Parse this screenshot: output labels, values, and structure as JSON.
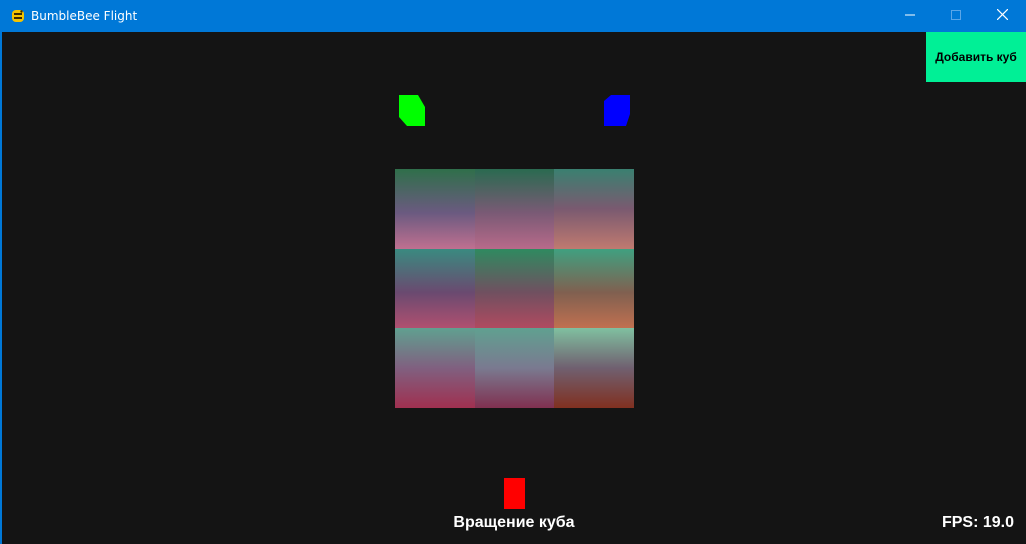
{
  "window": {
    "title": "BumbleBee Flight",
    "icon": "python-snake-icon",
    "controls": [
      "minimize-icon",
      "maximize-icon",
      "close-icon"
    ]
  },
  "canvas": {
    "background": "#141414",
    "add_cube_label": "Добавить куб",
    "add_cube_color": "#00f096",
    "caption": "Вращение куба",
    "fps_text": "FPS: 19.0"
  },
  "markers": {
    "green": "#00ff00",
    "blue": "#0000ff",
    "red": "#ff0000"
  },
  "cube_face": [
    "linear-gradient(to bottom, #2f6f4a 0%, #6b5a80 55%, #c07090 100%)",
    "linear-gradient(to bottom, #2a6a50 0%, #7a5a75 55%, #b86a8a 100%)",
    "linear-gradient(to bottom, #3a8070 0%, #7a5a70 50%, #c07a70 100%)",
    "linear-gradient(to bottom, #3a8a80 0%, #6a4a70 55%, #b05070 100%)",
    "linear-gradient(to bottom, #2f8a60 0%, #705060 55%, #b04a60 100%)",
    "linear-gradient(to bottom, #40a080 0%, #806050 55%, #c07050 100%)",
    "linear-gradient(to bottom, #60a090 0%, #806080 50%, #a03050 100%)",
    "linear-gradient(to bottom, #60a090 0%, #7a7a90 50%, #803050 100%)",
    "linear-gradient(to bottom, #80c0a0 0%, #706070 50%, #803020 100%)"
  ]
}
